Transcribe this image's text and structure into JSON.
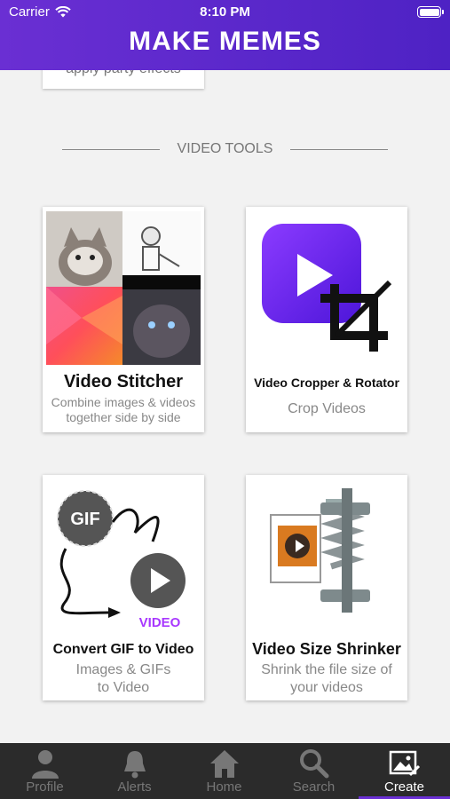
{
  "status_bar": {
    "carrier": "Carrier",
    "time": "8:10 PM"
  },
  "header": {
    "title": "MAKE MEMES"
  },
  "partial_card": {
    "text": "apply party effects"
  },
  "section": {
    "label": "VIDEO TOOLS"
  },
  "cards": [
    {
      "title": "Video Stitcher",
      "subtitle_lines": [
        "Combine images & videos",
        "together side by side"
      ]
    },
    {
      "title": "Video Cropper & Rotator",
      "subtitle_lines": [
        "Crop Videos"
      ]
    },
    {
      "title": "Convert GIF to Video",
      "subtitle_lines": [
        "Images & GIFs",
        "to Video"
      ]
    },
    {
      "title": "Video Size Shrinker",
      "subtitle_lines": [
        "Shrink the file size of",
        "your videos"
      ]
    }
  ],
  "thumb_text": {
    "gif": "GIF",
    "video": "VIDEO"
  },
  "tabs": [
    {
      "label": "Profile",
      "icon": "person-icon"
    },
    {
      "label": "Alerts",
      "icon": "bell-icon"
    },
    {
      "label": "Home",
      "icon": "home-icon"
    },
    {
      "label": "Search",
      "icon": "search-icon"
    },
    {
      "label": "Create",
      "icon": "image-edit-icon",
      "active": true
    }
  ],
  "colors": {
    "brand": "#5a28cc",
    "tabbar": "#2b2b2b",
    "background": "#f2f2f2"
  }
}
